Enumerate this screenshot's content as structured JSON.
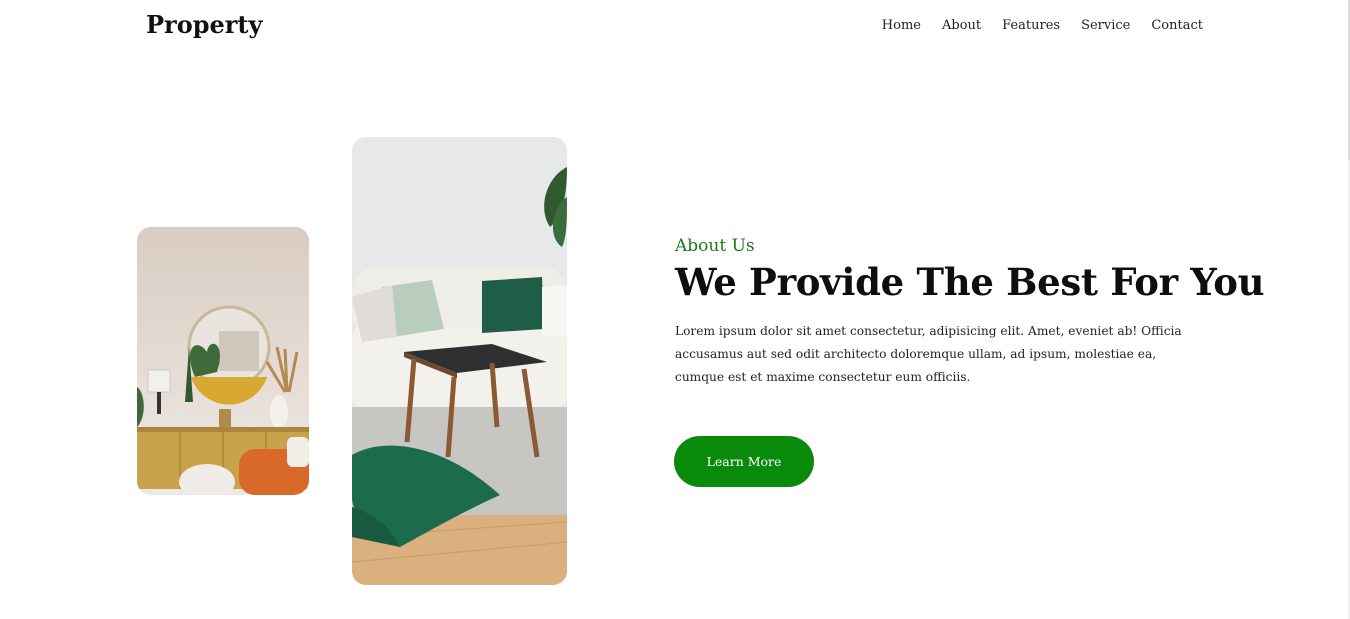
{
  "header": {
    "brand": "Property",
    "nav": [
      {
        "label": "Home"
      },
      {
        "label": "About"
      },
      {
        "label": "Features"
      },
      {
        "label": "Service"
      },
      {
        "label": "Contact"
      }
    ]
  },
  "about": {
    "eyebrow": "About Us",
    "title": "We Provide The Best For You",
    "paragraph": "Lorem ipsum dolor sit amet consectetur, adipisicing elit. Amet, eveniet ab! Officia accusamus aut sed odit architecto doloremque ullam, ad ipsum, molestiae ea, cumque est et maxime consectetur eum officiis.",
    "button_label": "Learn More"
  },
  "colors": {
    "accent": "#0a8a0a",
    "eyebrow": "#1b7a1b",
    "text": "#111111"
  },
  "images": [
    {
      "icon": "living-room-sideboard-photo"
    },
    {
      "icon": "living-room-sofa-photo"
    }
  ]
}
